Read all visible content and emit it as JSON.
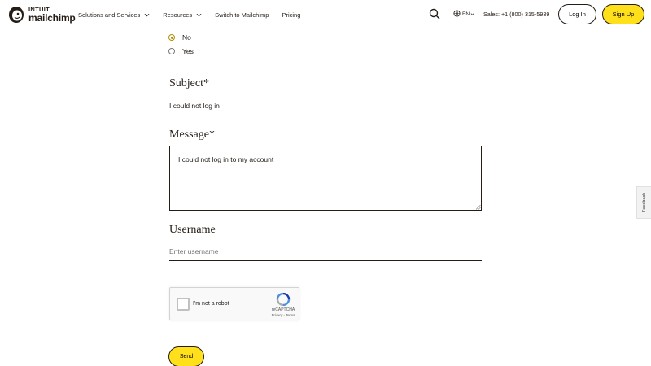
{
  "header": {
    "logo": {
      "top_line": "INTUIT",
      "bottom_line": "mailchimp",
      "icon": "freddie-icon"
    },
    "nav": [
      {
        "label": "Solutions and Services",
        "has_dropdown": true
      },
      {
        "label": "Resources",
        "has_dropdown": true
      },
      {
        "label": "Switch to Mailchimp",
        "has_dropdown": false
      },
      {
        "label": "Pricing",
        "has_dropdown": false
      }
    ],
    "language": "EN",
    "sales": "Sales: +1 (800) 315-5939",
    "login_label": "Log In",
    "signup_label": "Sign Up"
  },
  "form": {
    "radio_options": [
      {
        "label": "No",
        "checked": true
      },
      {
        "label": "Yes",
        "checked": false
      }
    ],
    "subject": {
      "label": "Subject*",
      "value": "I could not log in"
    },
    "message": {
      "label": "Message*",
      "value": "I could not log in to my account"
    },
    "username": {
      "label": "Username",
      "value": "",
      "placeholder": "Enter username"
    },
    "recaptcha": {
      "label": "I'm not a robot",
      "brand": "reCAPTCHA",
      "links": "Privacy - Terms"
    },
    "send_label": "Send"
  },
  "feedback_label": "Feedback",
  "colors": {
    "accent_yellow": "#ffe01b",
    "text": "#241c15",
    "radio_checked": "#b08c00"
  }
}
